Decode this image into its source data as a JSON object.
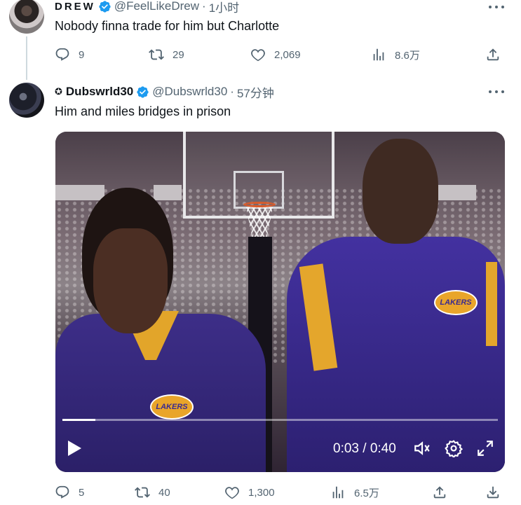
{
  "tweet1": {
    "display_name": "DREW",
    "handle": "@FeelLikeDrew",
    "separator": "·",
    "time": "1小时",
    "text": "Nobody finna trade for him but Charlotte",
    "replies": "9",
    "retweets": "29",
    "likes": "2,069",
    "views": "8.6万"
  },
  "tweet2": {
    "name_prefix_icon": "star-icon",
    "display_name": "Dubswrld30",
    "handle": "@Dubswrld30",
    "separator": "·",
    "time": "57分钟",
    "text": "Him and miles bridges in prison",
    "replies": "5",
    "retweets": "40",
    "likes": "1,300",
    "views": "6.5万",
    "video": {
      "current_time": "0:03",
      "duration": "0:40",
      "time_display": "0:03 / 0:40",
      "progress": 0.075,
      "logo_text": "LAKERS"
    }
  },
  "colors": {
    "text_primary": "#0f1419",
    "text_secondary": "#536471",
    "verified_blue": "#1d9bf0",
    "thread_line": "#cfd9de"
  }
}
